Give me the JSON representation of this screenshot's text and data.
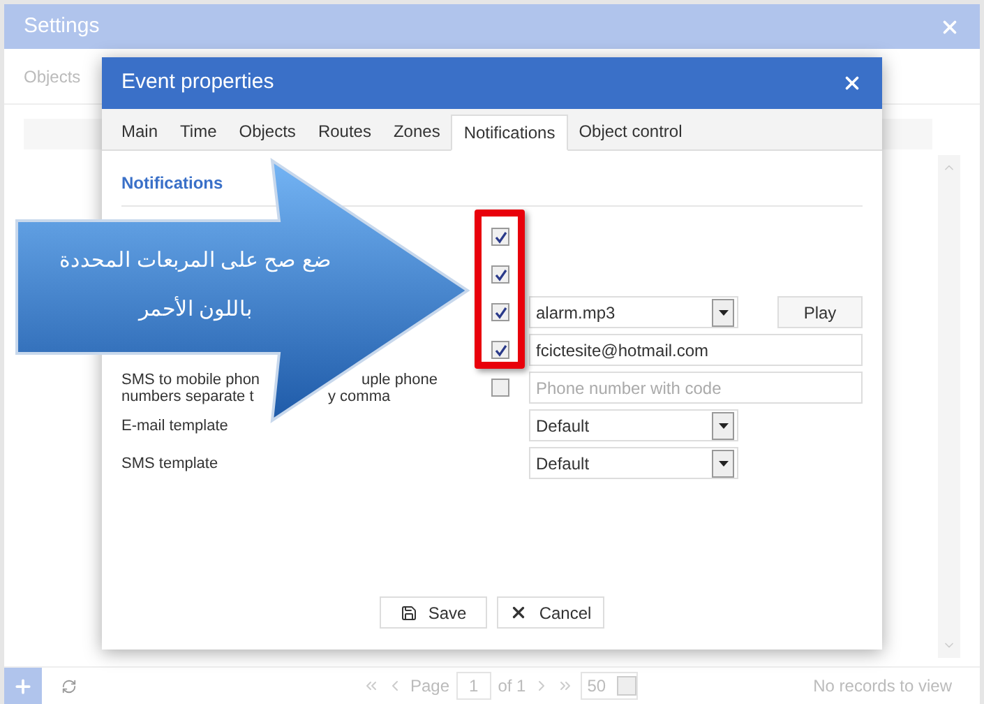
{
  "settings": {
    "title": "Settings",
    "tab": "Objects",
    "pager": {
      "page_label": "Page",
      "page": "1",
      "of": "of 1",
      "per_page": "50"
    },
    "status": "No records to view"
  },
  "dialog": {
    "title": "Event properties",
    "tabs": [
      {
        "label": "Main",
        "selected": false
      },
      {
        "label": "Time",
        "selected": false
      },
      {
        "label": "Objects",
        "selected": false
      },
      {
        "label": "Routes",
        "selected": false
      },
      {
        "label": "Zones",
        "selected": false
      },
      {
        "label": "Notifications",
        "selected": true
      },
      {
        "label": "Object control",
        "selected": false
      }
    ],
    "section": "Notifications",
    "rows": [
      {
        "kind": "check",
        "checked": true
      },
      {
        "kind": "check",
        "checked": true
      },
      {
        "kind": "sound",
        "checked": true,
        "value": "alarm.mp3",
        "button": "Play"
      },
      {
        "kind": "text",
        "checked": true,
        "value": "fcictesite@hotmail.com"
      },
      {
        "kind": "text",
        "checked": false,
        "placeholder": "Phone number with code",
        "label_lines": [
          [
            "SMS to mobile phon",
            "uple phone"
          ],
          [
            "numbers separate t",
            "y comma"
          ]
        ]
      },
      {
        "kind": "select",
        "label": "E-mail template",
        "value": "Default"
      },
      {
        "kind": "select",
        "label": "SMS template",
        "value": "Default"
      }
    ],
    "buttons": [
      {
        "kind": "save",
        "label": "Save"
      },
      {
        "kind": "cancel",
        "label": "Cancel"
      }
    ]
  },
  "callout": {
    "lines": [
      "ضع صح على المربعات المحددة",
      "باللون الأحمر"
    ]
  }
}
